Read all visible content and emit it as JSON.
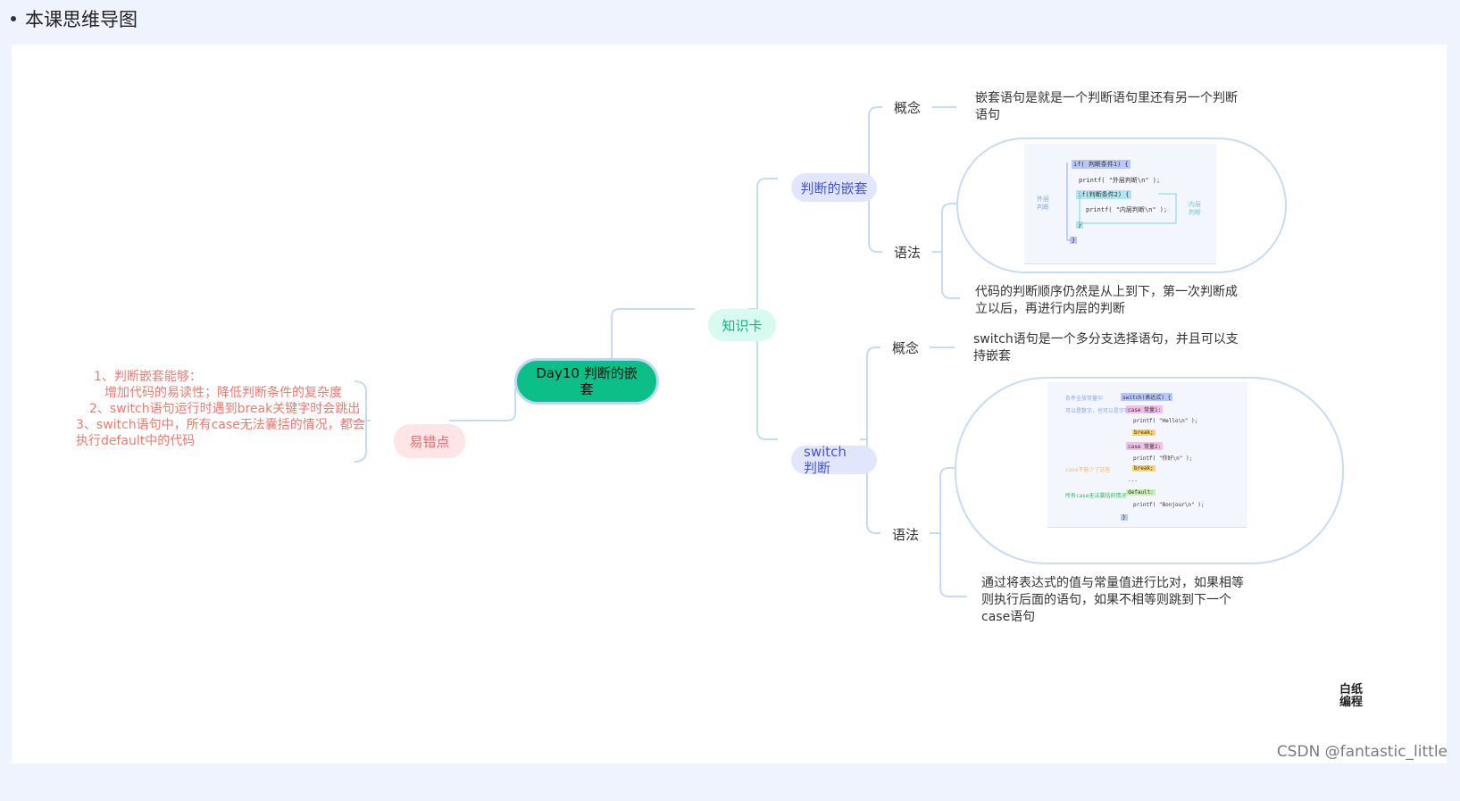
{
  "header": {
    "title": "本课思维导图"
  },
  "mindmap": {
    "root": "Day10 判断的嵌套",
    "branch_knowledge": "知识卡",
    "branch_mistakes": "易错点",
    "nested": {
      "label": "判断的嵌套",
      "concept_label": "概念",
      "concept_text": "嵌套语句是就是一个判断语句里还有另一个判断语句",
      "syntax_label": "语法",
      "syntax_note": "代码的判断顺序仍然是从上到下，第一次判断成立以后，再进行内层的判断",
      "code": {
        "outer_open": "if( 判断条件1) {",
        "outer_print": "printf( \"外层判断\\n\" );",
        "inner_open": "if(判断条件2) {",
        "inner_print": "printf( \"内层判断\\n\" );",
        "inner_close": "}",
        "outer_close": "}",
        "outer_note": "外层判断",
        "inner_note": "内层判断"
      }
    },
    "switch": {
      "label": "switch判断",
      "concept_label": "概念",
      "concept_text": "switch语句是一个多分支选择语句，并且可以支持嵌套",
      "syntax_label": "语法",
      "syntax_note": "通过将表达式的值与常量值进行比对，如果相等则执行后面的语句，如果不相等则跳到下一个case语句",
      "code": {
        "head": "switch(表达式) {",
        "case1": "case 常量1:",
        "print1": "printf( \"Hello\\n\" );",
        "break1": "break;",
        "case2": "case 常量2:",
        "print2": "printf( \"你好\\n\" );",
        "break2": "break;",
        "ellipsis": "...",
        "default": "default:",
        "print3": "printf( \"Bonjour\\n\" );",
        "close": "}",
        "note_condition": "条件全放常量中",
        "note_case": "可以是数字，也可以是字符",
        "note_break": "case不能少了这些",
        "note_default": "所有case无法囊括的情况"
      }
    },
    "mistakes": [
      "1、判断嵌套能够：",
      "增加代码的易读性；降低判断条件的复杂度",
      "2、switch语句运行时遇到break关键字时会跳出",
      "3、switch语句中，所有case无法囊括的情况，都会执行default中的代码"
    ]
  },
  "logo": {
    "line1": "白纸",
    "line2": "编程"
  },
  "watermark": "CSDN @fantastic_little",
  "colors": {
    "root": "#0cbf88",
    "knowledge_bg": "#d8fbef",
    "mistake_bg": "#ffe5e5",
    "branch_bg": "#e2e6fd",
    "connector": "#c6dcf6",
    "mistake_text": "#f07a70"
  }
}
